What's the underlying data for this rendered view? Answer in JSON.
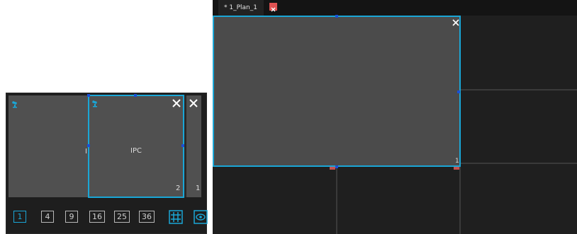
{
  "left_panel": {
    "cells": [
      {
        "label": "IPC",
        "number": "1"
      },
      {
        "label": "IPC",
        "number": "2"
      }
    ],
    "close_glyph": "✕"
  },
  "toolbar": {
    "buttons": [
      "1",
      "4",
      "9",
      "16",
      "25",
      "36"
    ],
    "active": "1",
    "extra_icons": [
      "custom-layout-icon",
      "preview-eye-icon"
    ],
    "accent": "#1aa6d6"
  },
  "tab": {
    "label": "* 1_Plan_1",
    "close_color": "#e05252"
  },
  "main_view": {
    "window_number": "1",
    "close_glyph": "✕"
  }
}
